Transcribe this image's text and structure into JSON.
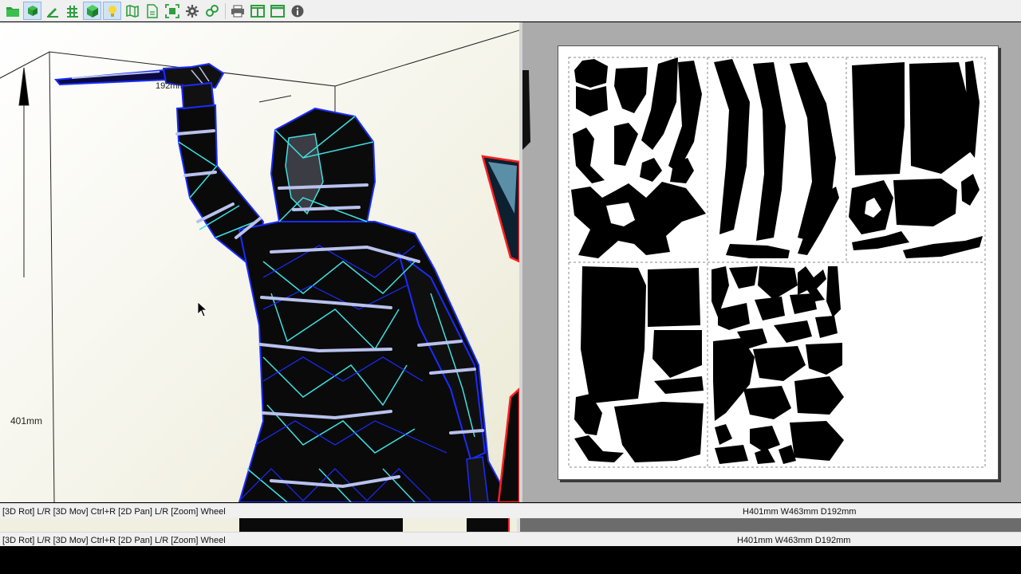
{
  "toolbar": {
    "buttons": [
      {
        "icon": "open-folder-icon",
        "color": "#2e9e3e"
      },
      {
        "icon": "unfold-icon",
        "color": "#2e9e3e"
      },
      {
        "icon": "edit-pen-icon",
        "color": "#2e9e3e"
      },
      {
        "icon": "fold-lines-icon",
        "color": "#2e9e3e"
      },
      {
        "icon": "cube-icon",
        "color": "#2e9e3e"
      },
      {
        "icon": "lightbulb-icon",
        "color": "#e8c21e"
      },
      {
        "icon": "map-icon",
        "color": "#2e9e3e"
      },
      {
        "icon": "document-icon",
        "color": "#2e9e3e"
      },
      {
        "icon": "fit-view-icon",
        "color": "#2e9e3e"
      },
      {
        "icon": "gear-icon",
        "color": "#555555"
      },
      {
        "icon": "link-icon",
        "color": "#2e9e3e"
      },
      {
        "icon": "printer-icon",
        "color": "#555555"
      },
      {
        "icon": "split-view-icon",
        "color": "#2e9e3e"
      },
      {
        "icon": "window-icon",
        "color": "#2e9e3e"
      },
      {
        "icon": "info-icon",
        "color": "#555555"
      }
    ]
  },
  "view3d": {
    "height_label": "401mm",
    "depth_label": "192mm"
  },
  "status": {
    "hint": "[3D Rot] L/R [3D Mov] Ctrl+R [2D Pan] L/R [Zoom] Wheel",
    "dimensions": "H401mm W463mm D192mm"
  },
  "colors": {
    "wire_blue": "#1a2cff",
    "wire_cyan": "#3ee0e0",
    "seam": "#b9c2ee",
    "part_red": "#ff2020"
  }
}
